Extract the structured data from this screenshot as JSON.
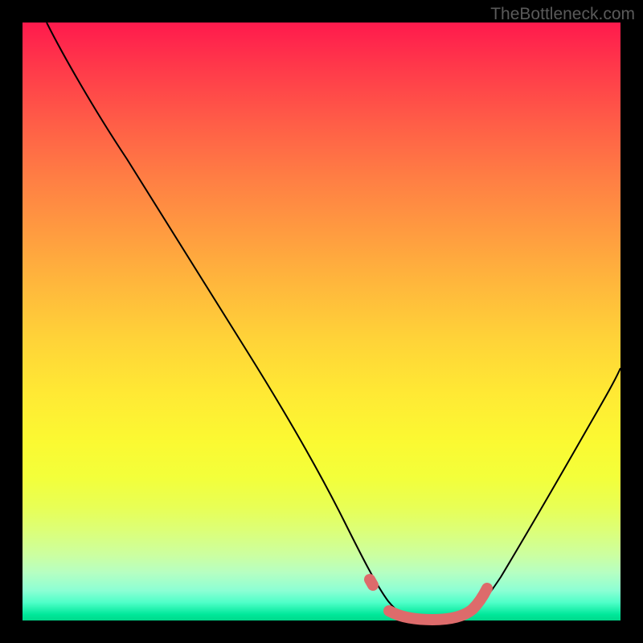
{
  "watermark": "TheBottleneck.com",
  "chart_data": {
    "type": "line",
    "title": "",
    "xlabel": "",
    "ylabel": "",
    "xlim": [
      0,
      100
    ],
    "ylim": [
      0,
      100
    ],
    "grid": false,
    "series": [
      {
        "name": "bottleneck-curve",
        "color": "#000000",
        "x": [
          4,
          8,
          14,
          22,
          30,
          38,
          46,
          52,
          56,
          60,
          64,
          68,
          72,
          76,
          82,
          88,
          94,
          100
        ],
        "values": [
          100,
          94,
          85,
          73,
          61,
          49,
          36,
          25,
          15,
          6,
          1,
          0,
          0,
          1,
          9,
          20,
          31,
          43
        ]
      },
      {
        "name": "highlight-band",
        "color": "#e06666",
        "x": [
          55,
          58,
          62,
          66,
          70,
          75
        ],
        "values": [
          5,
          1,
          0,
          0,
          0,
          2
        ]
      }
    ],
    "annotations": []
  }
}
